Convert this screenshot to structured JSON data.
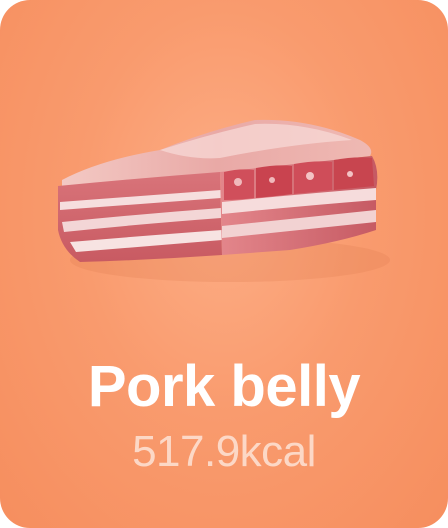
{
  "food_card": {
    "image_icon": "pork-belly-image",
    "name": "Pork belly",
    "calories": "517.9kcal",
    "background_color": "#f99b6e",
    "text_color": "#ffffff"
  }
}
